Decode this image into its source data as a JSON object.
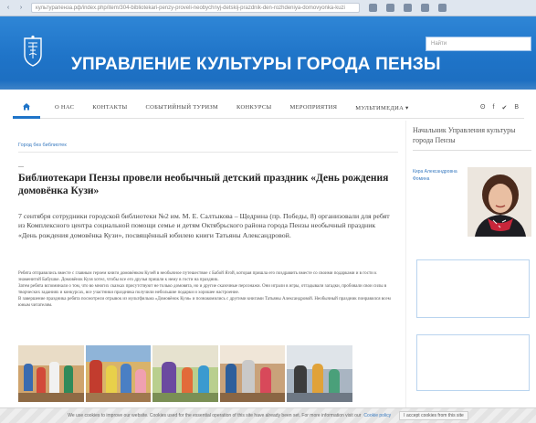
{
  "browser": {
    "url": "культурапенза.рф/index.php/item/304-bibliotekari-penzy-proveli-neobychnyj-detskij-prazdnik-den-rozhdeniya-domovyonka-kuzi",
    "back_glyph": "‹",
    "forward_glyph": "›"
  },
  "header": {
    "site_title": "УПРАВЛЕНИЕ КУЛЬТУРЫ ГОРОДА ПЕНЗЫ",
    "search_placeholder": "Найти"
  },
  "nav": {
    "home_icon": "home-icon",
    "items": [
      "О нас",
      "Контакты",
      "Событийный туризм",
      "Конкурсы",
      "Мероприятия",
      "Мультимедиа ▾"
    ],
    "social_icons": [
      "ok-icon",
      "facebook-icon",
      "twitter-icon",
      "vk-icon"
    ],
    "social_glyphs": [
      "ʘ",
      "f",
      "✔",
      "B"
    ]
  },
  "main": {
    "breadcrumb": "Город без библиотек",
    "dash": "—",
    "title": "Библиотекари Пензы провели необычный детский праздник «День рождения домовёнка Кузи»",
    "lead": "7 сентября сотрудники городской библиотеки №2 им. М. Е. Салтыкова – Щедрина (пр. Победы, 8) организовали для ребят из Комплексного центра социальной помощи семье и детям Октябрьского района города Пензы необычный праздник «День рождения домовёнка Кузи», посвящённый юбилею книги Татьяны Александровой.",
    "body": [
      "Ребята отправились вместе с главным героем книги домовёнком Кузей в необычное путешествие с Бабой Ягой, которая пришла его поздравить вместе со своими подарками и в гости к знаменитой Бабушке. Домовёнок Кузя хотел, чтобы все его друзья пришли к нему в гости на праздник.",
      "Затем ребята вспоминали о том, что во многих сказках присутствуют не только домовята, но и другие сказочные персонажи. Они играли в игры, отгадывали загадки, пробовали свои силы в творческих заданиях и конкурсах, все участники праздника получили небольшие подарки и хорошее настроение.",
      "В завершение праздника ребята посмотрели отрывок из мультфильма «Домовёнок Кузя» и познакомились с другими книгами Татьяны Александровой. Необычный праздник понравился всем юным читателям."
    ],
    "gallery_count": 5
  },
  "sidebar": {
    "head_title": "Начальник Управления культуры города Пензы",
    "head_name": "Кира Александровна Фомина"
  },
  "cookie": {
    "text": "We use cookies to improve our website. Cookies used for the essential operation of this site have already been set. For more information visit our",
    "link": "Cookie policy",
    "button": "I accept cookies from this site"
  },
  "colors": {
    "header_blue": "#1f74c8",
    "link_blue": "#3a7bc0",
    "widget_border": "#b9d4ef"
  }
}
